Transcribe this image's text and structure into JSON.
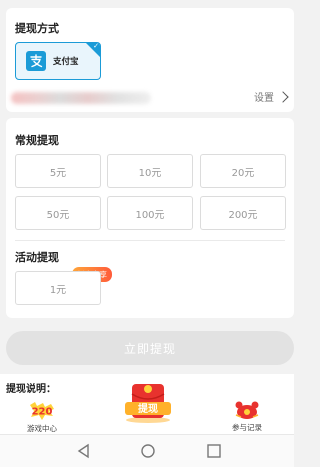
{
  "payment": {
    "section_title": "提现方式",
    "selected_method": "支付宝",
    "settings_label": "设置"
  },
  "regular": {
    "section_title": "常规提现",
    "amounts": [
      "5元",
      "10元",
      "20元",
      "50元",
      "100元",
      "200元"
    ]
  },
  "activity": {
    "section_title": "活动提现",
    "badge": "新人专享",
    "amounts": [
      "1元"
    ]
  },
  "withdraw_button": "立即提现",
  "explanation_title": "提现说明：",
  "bottom": {
    "game_center": "游戏中心",
    "game_logo_text": "220",
    "withdraw_icon_text": "提现",
    "records": "参与记录"
  },
  "colors": {
    "accent": "#1b9bd7",
    "badge_gradient": [
      "#ffa63a",
      "#ff5b3a"
    ],
    "disabled_button": "#e2e2e2"
  },
  "icons": [
    "alipay-icon",
    "check-icon",
    "chevron-right-icon",
    "game-center-icon",
    "red-envelope-icon",
    "records-icon",
    "back-icon",
    "home-icon",
    "recents-icon"
  ]
}
